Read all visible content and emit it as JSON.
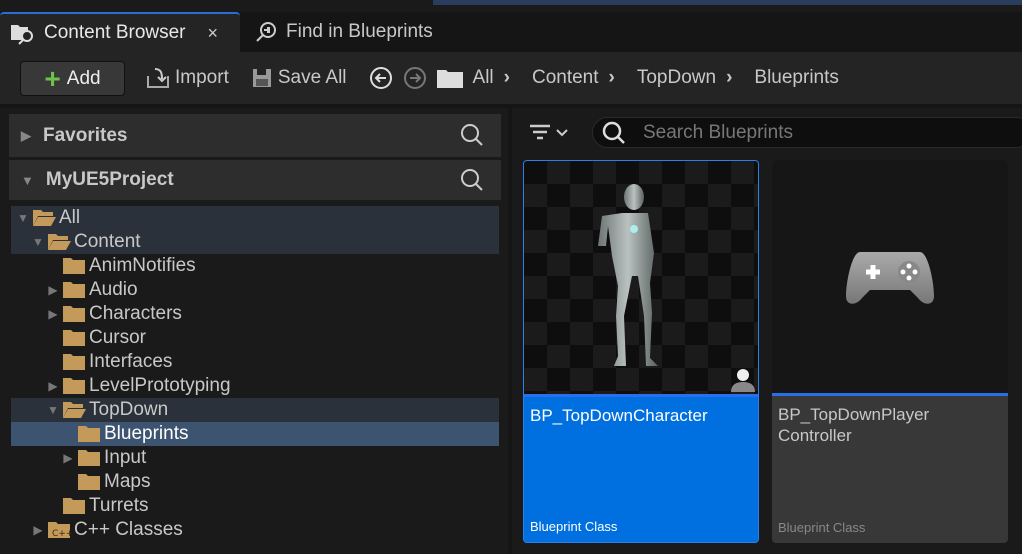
{
  "tabs": [
    {
      "label": "Content Browser",
      "close": "×",
      "icon": "content-browser-icon"
    },
    {
      "label": "Find in Blueprints",
      "icon": "find-blueprints-icon"
    }
  ],
  "toolbar": {
    "add_label": "Add",
    "import_label": "Import",
    "save_all_label": "Save All"
  },
  "breadcrumb": [
    "All",
    "Content",
    "TopDown",
    "Blueprints"
  ],
  "sidebar": {
    "favorites": "Favorites",
    "project": "MyUE5Project",
    "tree": [
      {
        "label": "All",
        "level": 0,
        "expanded": true,
        "hl": true
      },
      {
        "label": "Content",
        "level": 1,
        "expanded": true,
        "hl": true
      },
      {
        "label": "AnimNotifies",
        "level": 2
      },
      {
        "label": "Audio",
        "level": 2,
        "collapsed": true
      },
      {
        "label": "Characters",
        "level": 2,
        "collapsed": true
      },
      {
        "label": "Cursor",
        "level": 2
      },
      {
        "label": "Interfaces",
        "level": 2
      },
      {
        "label": "LevelPrototyping",
        "level": 2,
        "collapsed": true
      },
      {
        "label": "TopDown",
        "level": 2,
        "expanded": true,
        "hl": true
      },
      {
        "label": "Blueprints",
        "level": 3,
        "selected": true
      },
      {
        "label": "Input",
        "level": 3,
        "collapsed": true
      },
      {
        "label": "Maps",
        "level": 3
      },
      {
        "label": "Turrets",
        "level": 2
      },
      {
        "label": "C++ Classes",
        "level": 1,
        "collapsed": true,
        "cpp": true
      }
    ]
  },
  "search": {
    "placeholder": "Search Blueprints"
  },
  "assets": [
    {
      "name": "BP_TopDownCharacter",
      "type": "Blueprint Class",
      "selected": true
    },
    {
      "name": "BP_TopDownPlayer Controller",
      "type": "Blueprint Class"
    }
  ],
  "colors": {
    "accent": "#0070e0",
    "folder": "#c39a5a",
    "add_icon": "#6cc24a"
  }
}
